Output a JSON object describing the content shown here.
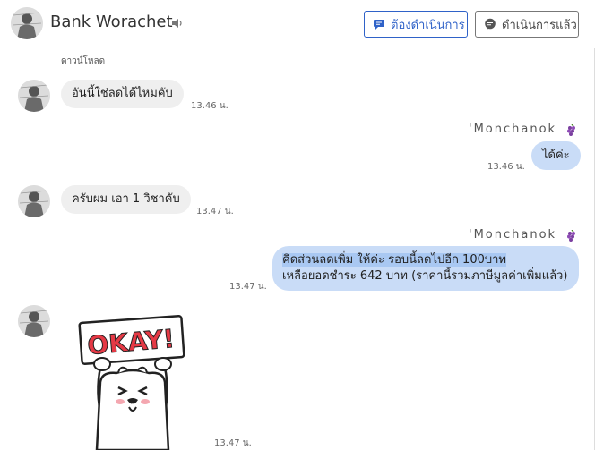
{
  "header": {
    "contact_name": "Bank Worachet",
    "speaker_icon": "speaker-icon",
    "todo_button": "ต้องดำเนินการ",
    "done_button": "ดำเนินการแล้ว"
  },
  "colors": {
    "accent": "#2f62c8",
    "outgoing_bubble": "#c9dcf7",
    "incoming_bubble": "#efefef"
  },
  "chat": {
    "download_label": "ดาวน์โหลด",
    "messages": [
      {
        "sender": "Bank Worachet",
        "direction": "in",
        "text": "อันนี้ใช่ลดได้ไหมคับ",
        "time": "13.46 น."
      },
      {
        "sender": "'Monchanok",
        "direction": "out",
        "text": "ได้ค่ะ",
        "time": "13.46 น."
      },
      {
        "sender": "Bank Worachet",
        "direction": "in",
        "text": "ครับผม เอา 1 วิชาคับ",
        "time": "13.47 น."
      },
      {
        "sender": "'Monchanok",
        "direction": "out",
        "line1": "คิดส่วนลดเพิ่ม ให้ค่ะ รอบนี้ลดไปอีก 100บาท",
        "line2": "เหลือยอดชำระ 642 บาท (ราคานี้รวมภาษีมูลค่าเพิ่มแล้ว)",
        "time": "13.47 น."
      },
      {
        "sender": "Bank Worachet",
        "direction": "in",
        "sticker_text": "OKAY!",
        "time": "13.47 น."
      }
    ]
  }
}
